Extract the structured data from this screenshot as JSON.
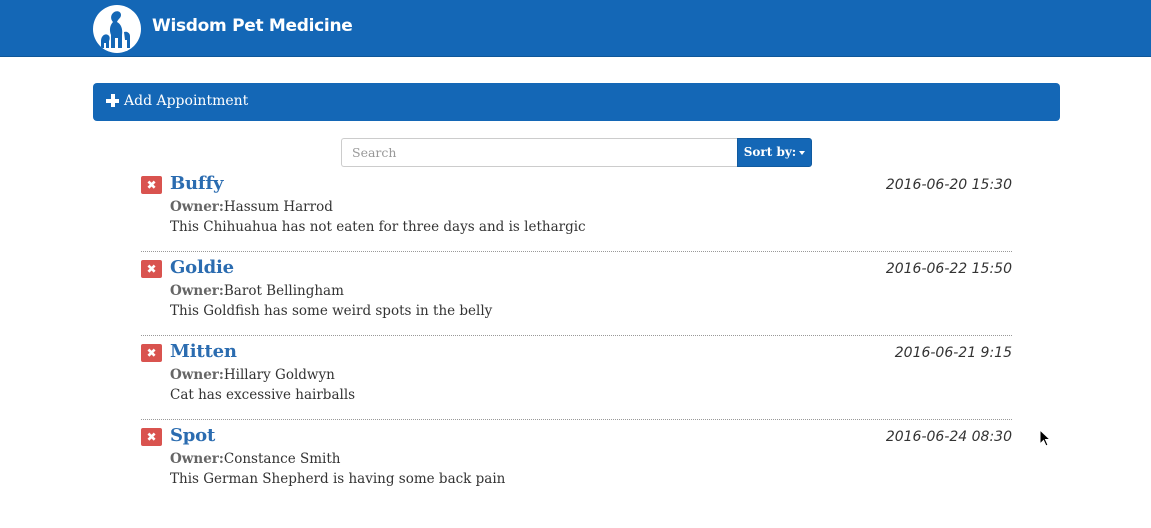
{
  "app": {
    "brand": "Wisdom Pet Medicine",
    "colors": {
      "primary": "#1467b6",
      "danger": "#d9534f",
      "link": "#2b6cb0"
    },
    "logo_icon": "pet-silhouette-icon"
  },
  "toolbar": {
    "add_label": "Add Appointment",
    "add_icon": "plus-icon"
  },
  "search": {
    "placeholder": "Search",
    "value": "",
    "sort_label": "Sort by:",
    "sort_icon": "caret-down-icon"
  },
  "appointments": [
    {
      "pet_name": "Buffy",
      "owner_label": "Owner:",
      "owner": "Hassum Harrod",
      "date": "2016-06-20 15:30",
      "notes": "This Chihuahua has not eaten for three days and is lethargic",
      "delete_glyph": "✖"
    },
    {
      "pet_name": "Goldie",
      "owner_label": "Owner:",
      "owner": "Barot Bellingham",
      "date": "2016-06-22 15:50",
      "notes": "This Goldfish has some weird spots in the belly",
      "delete_glyph": "✖"
    },
    {
      "pet_name": "Mitten",
      "owner_label": "Owner:",
      "owner": "Hillary Goldwyn",
      "date": "2016-06-21 9:15",
      "notes": "Cat has excessive hairballs",
      "delete_glyph": "✖"
    },
    {
      "pet_name": "Spot",
      "owner_label": "Owner:",
      "owner": "Constance Smith",
      "date": "2016-06-24 08:30",
      "notes": "This German Shepherd is having some back pain",
      "delete_glyph": "✖"
    }
  ]
}
